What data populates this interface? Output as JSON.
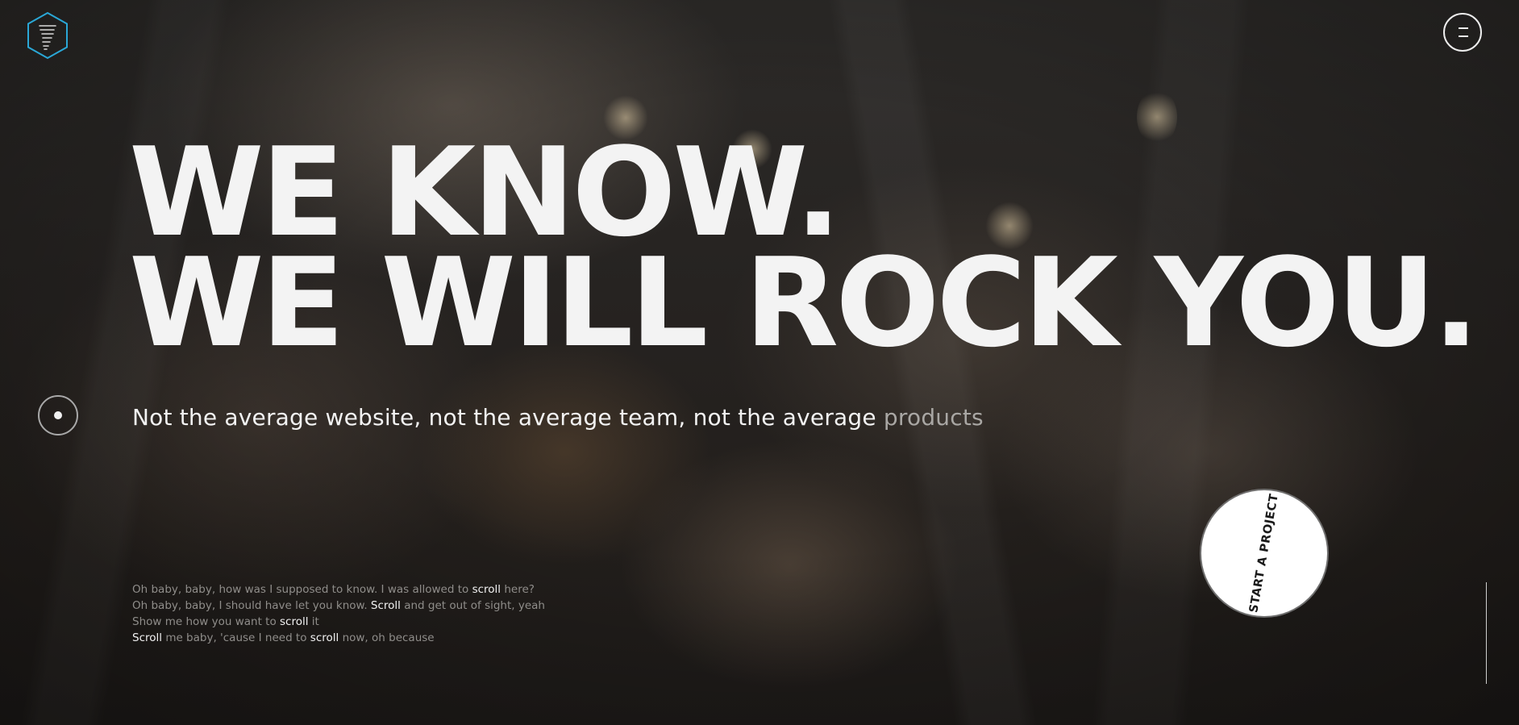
{
  "header": {
    "logo_icon": "tornado-hexagon-logo",
    "menu_icon": "hamburger-menu-icon"
  },
  "hero": {
    "headline_line1": "WE KNOW.",
    "headline_line2": "WE WILL ROCK YOU.",
    "tagline_main": "Not the average website, not the average team, not the average",
    "tagline_accent": "products"
  },
  "lyrics": {
    "line1": {
      "a": "Oh baby, baby, how was I supposed to know. I was allowed to",
      "b": "scroll",
      "c": "here?"
    },
    "line2": {
      "a": "Oh baby, baby, I should have let you know.",
      "b": "Scroll",
      "c": "and get out of sight, yeah"
    },
    "line3": {
      "a": "Show me how you want to",
      "b": "scroll",
      "c": "it"
    },
    "line4": {
      "a": "Scroll",
      "b": "me baby, 'cause I need to",
      "c": "scroll",
      "d": "now, oh because"
    }
  },
  "cta": {
    "start_project_label": "START A PROJECT"
  },
  "colors": {
    "logo_accent": "#2aa7d6",
    "text_primary": "#f3f3f3",
    "text_muted": "#8f8d8a"
  }
}
